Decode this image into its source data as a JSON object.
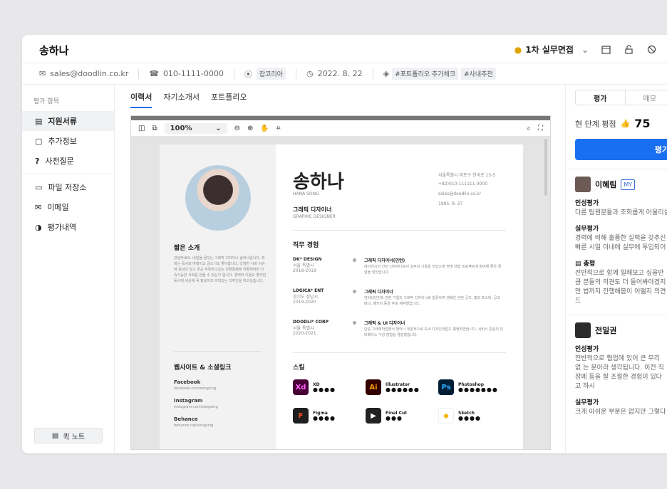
{
  "header": {
    "name": "송하나",
    "stage": "1차 실무면접"
  },
  "meta": {
    "email": "sales@doodlin.co.kr",
    "phone": "010-1111-0000",
    "source": "잡코리아",
    "date": "2022. 8. 22",
    "tags": [
      "#포트폴리오 추가체크",
      "#사내추천"
    ]
  },
  "sidebar": {
    "title": "평가 항목",
    "items": [
      "지원서류",
      "추가정보",
      "사전질문"
    ],
    "items2": [
      "파일 저장소",
      "이메일",
      "평가내역"
    ],
    "quick_note": "퀵 노트"
  },
  "tabs": [
    "이력서",
    "자기소개서",
    "포트폴리오"
  ],
  "viewer": {
    "zoom": "100%"
  },
  "resume": {
    "name": "송하나",
    "name_en": "HANA SONG",
    "role": "그래픽 디자이너",
    "role_en": "GRAPHIC DESIGNER",
    "contact": [
      "서울특별시 마포구 한국로 13-5",
      "+82)010-111111-0000",
      "sales@doodlin.co.kr",
      "1995. 9. 27"
    ],
    "intro_title": "짧은 소개",
    "intro": "안녕하세요. 내일을 꿈꾸는 그래픽 디자이너 송하나입니다. 취미는 독서와 여행이고 글쓰기도 좋아합니다. 다양한 사회 이슈에 관심이 많고 최근 주목하고있는 친환경제에 어떻게하면 지속가능한 사회를 만들 수 있는가 입니다. 경력의 이용도 좋지만 동시에 세상에 꼭 필요하고 의미있는 디자인을 하고싶습니다.",
    "links_title": "웹사이트 & 소셜링크",
    "links": [
      {
        "n": "Facebook",
        "u": "facebook.com/songsing"
      },
      {
        "n": "Instagram",
        "u": "instagram.com/songsing"
      },
      {
        "n": "Behance",
        "u": "behance.net/songsing"
      }
    ],
    "exp_title": "직무 경험",
    "jobs": [
      {
        "c": "DK* DESIGN",
        "l": "서울 특별시",
        "y": "2018-2019",
        "t": "그래픽 디자이너(인턴)",
        "d": "에이전시의 인턴 디자이너로서 실무의 기틀을 닦았으며 몇몇 대형 프로젝트에 참여해 좋은 경험을 쌓았습니다."
      },
      {
        "c": "LOGICA* ENT",
        "l": "경기도 성남시",
        "y": "2019-2020",
        "t": "그래픽 디자이너",
        "d": "엔터테인먼트 관련 기업의 그래픽 디자이너로 합류하여 앤배인 관련 굿즈, 홍보 포스터, 공고 배너, 패키지 등을 주로 제작했습니다."
      },
      {
        "c": "DOODLI* CORP",
        "l": "서울 특별시",
        "y": "2020-2021",
        "t": "그래픽 & UI 디자이너",
        "d": "단순 그래픽작업에서 벗어나 부분적으로 GUI 디자인작업도 병행하였습니다. 서비스 중심의 인터페이스 구성 방법을 경험했습니다."
      }
    ],
    "skills_title": "스킬",
    "skills": [
      {
        "n": "XD",
        "lv": "●●●●",
        "c": "#470137",
        "g": "Xd",
        "fc": "#ff61f6"
      },
      {
        "n": "Illustrator",
        "lv": "●●●●●●",
        "c": "#330000",
        "g": "Ai",
        "fc": "#ff9a00"
      },
      {
        "n": "Photoshop",
        "lv": "●●●●●●●",
        "c": "#001e36",
        "g": "Ps",
        "fc": "#31a8ff"
      },
      {
        "n": "Figma",
        "lv": "●●●●",
        "c": "#1e1e1e",
        "g": "F",
        "fc": "#f24e1e"
      },
      {
        "n": "Final Cut",
        "lv": "●●●",
        "c": "#222",
        "g": "▶",
        "fc": "#fff"
      },
      {
        "n": "Sketch",
        "lv": "●●●●",
        "c": "#fff",
        "g": "◆",
        "fc": "#f7b500"
      }
    ]
  },
  "panel": {
    "tab_eval": "평가",
    "tab_memo": "메모",
    "score_label": "현 단계 평점",
    "score": "75",
    "eval_btn": "평가",
    "r1": {
      "name": "이혜림",
      "badge": "MY",
      "h1": "인성평가",
      "t1": "다른 팀원분들과 조화롭게 어울리실 것으로 보입니다. 그러면서도 자신이 달해 주시네요. 좋게 보여집니다.",
      "h2": "실무평가",
      "t2": "경력에 비해 훌륭한 실력을 갖추신 빠른 시일 이내에 실무에 투입되어",
      "h3": "총평",
      "t3": "전반적으로 함께 일해보고 싶을만큼 분들의 의견도 더 들어봐야겠지만 법까지 진행해봄이 어떨지 의견 드"
    },
    "r2": {
      "name": "전일권",
      "h1": "인성평가",
      "t1": "전반적으로 협업에 있어 큰 무리 없 는 분이라 생각됩니다. 이전 직장에 등을 잘 조절한 경험이 있다고 하시",
      "h2": "실무평가",
      "t2": "크게 아쉬운 부분은 없지만 그렇다"
    }
  }
}
